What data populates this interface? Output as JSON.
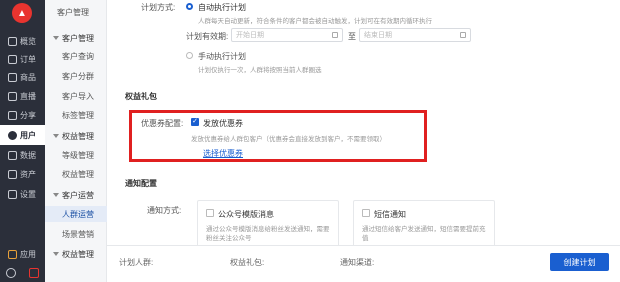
{
  "rail": {
    "logo": "▲",
    "items": [
      {
        "label": "概览",
        "icon": "dashboard-icon"
      },
      {
        "label": "订单",
        "icon": "order-icon"
      },
      {
        "label": "商品",
        "icon": "goods-icon"
      },
      {
        "label": "直播",
        "icon": "live-icon"
      },
      {
        "label": "分享",
        "icon": "share-icon"
      },
      {
        "label": "用户",
        "icon": "user-icon"
      },
      {
        "label": "数据",
        "icon": "data-icon"
      },
      {
        "label": "资产",
        "icon": "asset-icon"
      },
      {
        "label": "设置",
        "icon": "settings-icon"
      }
    ],
    "apps": "应用"
  },
  "subnav": {
    "top": "客户管理",
    "groups": [
      {
        "label": "客户管理",
        "children": [
          "客户查询",
          "客户分群",
          "客户导入",
          "标签管理"
        ]
      },
      {
        "label": "权益管理",
        "children": [
          "等级管理",
          "权益管理"
        ]
      },
      {
        "label": "客户运营",
        "children": [
          "人群运营",
          "场景营销"
        ]
      },
      {
        "label": "权益管理",
        "children": []
      }
    ],
    "active": "人群运营"
  },
  "form": {
    "send_mode_label": "计划方式:",
    "option_auto": "自动执行计划",
    "option_auto_hint": "人群每天自动更新，符合条件的客户都会被自动触发，计划可在有效期内循环执行",
    "valid_period_label": "计划有效期:",
    "start_placeholder": "开始日期",
    "end_placeholder": "结束日期",
    "range_sep": "至",
    "option_manual": "手动执行计划",
    "option_manual_hint": "计划仅执行一次，人群将按照当前人群圈选"
  },
  "benefit": {
    "section": "权益礼包",
    "coupon_label": "优惠券配置:",
    "coupon_option": "发放优惠券",
    "coupon_hint": "发放优惠券给人群包客户（优惠券会直接发放到客户，不需要领取）",
    "select_link": "选择优惠券"
  },
  "notify": {
    "section": "通知配置",
    "method_label": "通知方式:",
    "options": [
      {
        "label": "公众号模版消息",
        "hint": "通过公众号模版消息给粉丝发送通知，需要粉丝关注公众号"
      },
      {
        "label": "短信通知",
        "hint": "通过短信给客户发送通知，短信需要提前充值"
      }
    ]
  },
  "footer": {
    "people": "计划人群:",
    "gift": "权益礼包:",
    "channel": "通知渠道:",
    "create_button": "创建计划"
  }
}
